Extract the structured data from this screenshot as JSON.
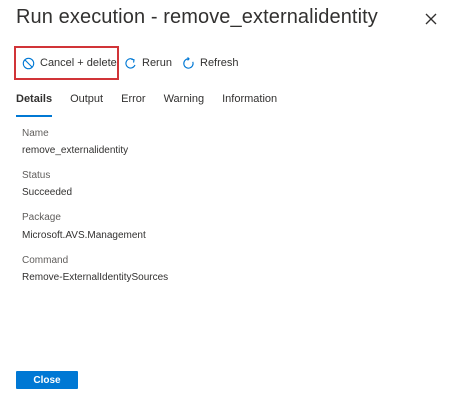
{
  "panel": {
    "title": "Run execution - remove_externalidentity"
  },
  "toolbar": {
    "cancel_label": "Cancel + delete",
    "rerun_label": "Rerun",
    "refresh_label": "Refresh",
    "highlight_color": "#d13438"
  },
  "tabs": [
    {
      "label": "Details",
      "active": true
    },
    {
      "label": "Output",
      "active": false
    },
    {
      "label": "Error",
      "active": false
    },
    {
      "label": "Warning",
      "active": false
    },
    {
      "label": "Information",
      "active": false
    }
  ],
  "details": {
    "name_label": "Name",
    "name_value": "remove_externalidentity",
    "status_label": "Status",
    "status_value": "Succeeded",
    "package_label": "Package",
    "package_value": "Microsoft.AVS.Management",
    "command_label": "Command",
    "command_value": "Remove-ExternalIdentitySources"
  },
  "footer": {
    "close_label": "Close"
  },
  "colors": {
    "accent": "#0078d4",
    "text": "#323130",
    "muted": "#605e5c"
  }
}
